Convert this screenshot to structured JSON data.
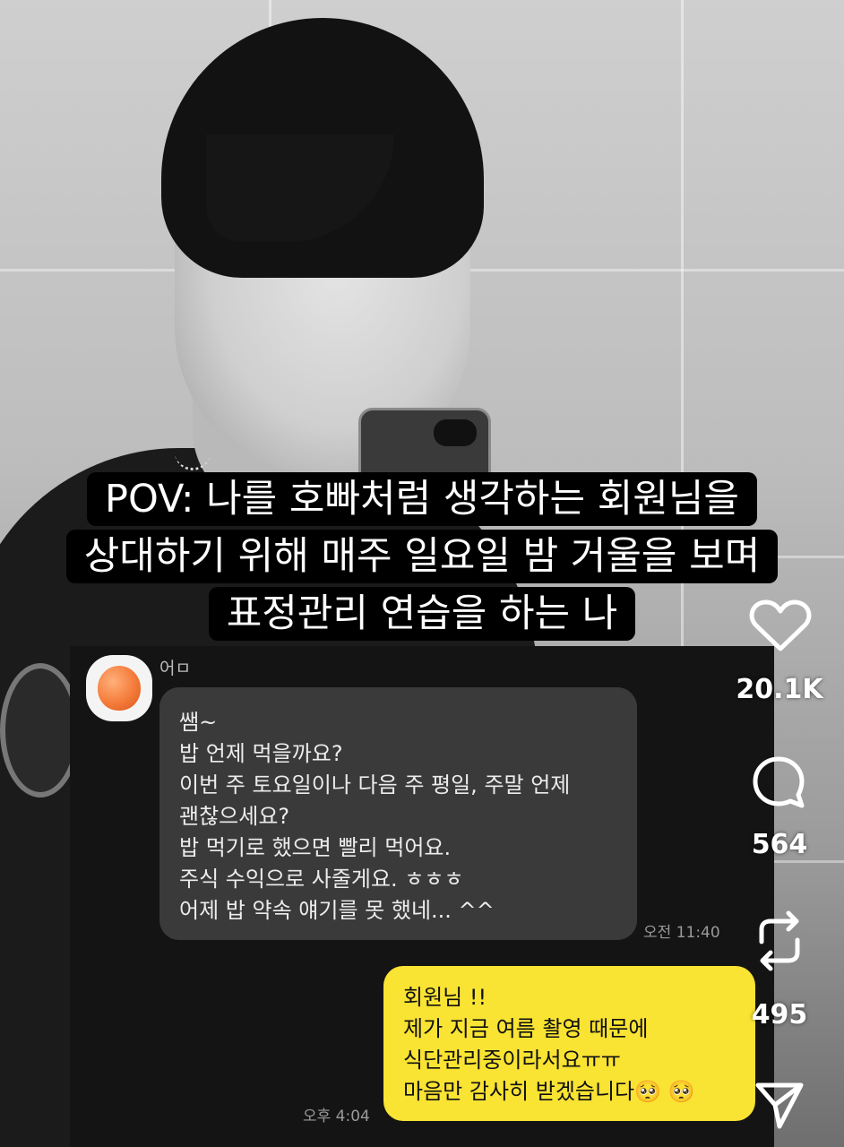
{
  "caption": {
    "lines": [
      "POV: 나를 호빠처럼 생각하는 회원님을",
      "상대하기 위해 매주 일요일 밤 거울을 보며",
      "표정관리 연습을 하는 나"
    ]
  },
  "chat": {
    "sender_name": "어ㅁ",
    "incoming": {
      "lines": [
        "쌤~",
        "밥 언제 먹을까요?",
        "이번 주 토요일이나 다음 주 평일, 주말 언제",
        "괜찮으세요?",
        "밥 먹기로 했으면 빨리 먹어요.",
        "주식 수익으로 사줄게요. ㅎㅎㅎ",
        "어제 밥 약속 얘기를 못 했네... ^^"
      ],
      "time": "오전 11:40"
    },
    "outgoing": {
      "lines": [
        "회원님 !!",
        "제가 지금 여름 촬영 때문에",
        "식단관리중이라서요ㅠㅠ",
        "마음만 감사히 받겠습니다🥺 🥺"
      ],
      "time": "오후 4:04"
    }
  },
  "actions": {
    "like_count": "20.1K",
    "comment_count": "564",
    "repost_count": "495",
    "icons": [
      "heart-icon",
      "comment-icon",
      "repost-icon",
      "share-icon"
    ]
  },
  "colors": {
    "outgoing_bubble": "#f9e333",
    "incoming_bubble": "#3a3a3a",
    "caption_bg": "#000000"
  }
}
